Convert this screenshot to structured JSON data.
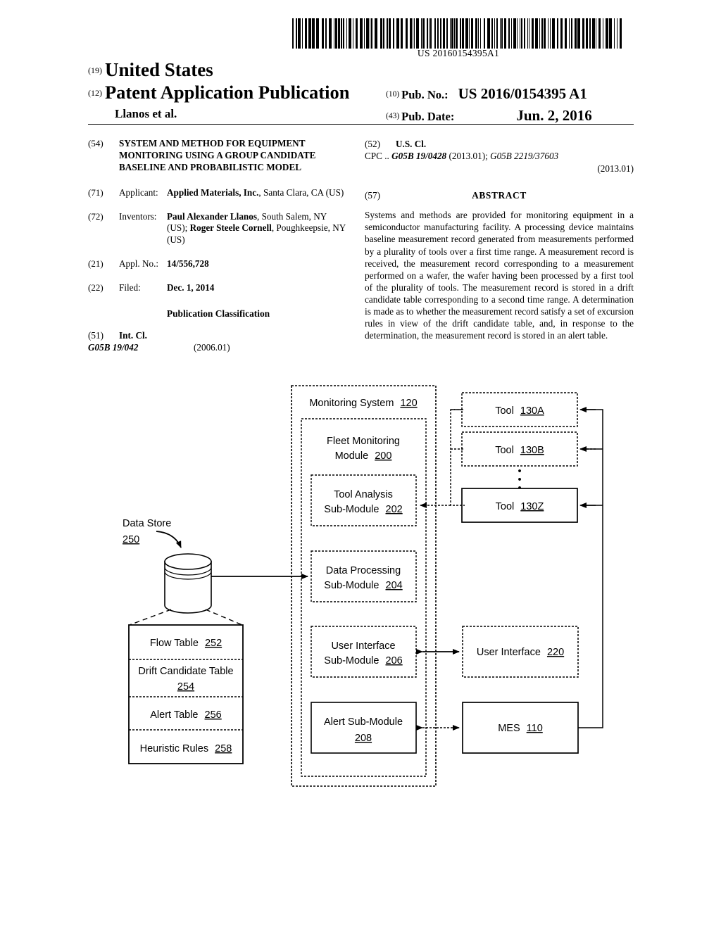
{
  "header": {
    "barcode_text": "US 20160154395A1",
    "country_num": "(19)",
    "country": "United States",
    "doc_type_num": "(12)",
    "doc_type": "Patent Application Publication",
    "author_line": "Llanos et al.",
    "pub_no_num": "(10)",
    "pub_no_label": "Pub. No.:",
    "pub_no_value": "US 2016/0154395 A1",
    "pub_date_num": "(43)",
    "pub_date_label": "Pub. Date:",
    "pub_date_value": "Jun. 2, 2016"
  },
  "left_column": {
    "title_num": "(54)",
    "title": "SYSTEM AND METHOD FOR EQUIPMENT MONITORING USING A GROUP CANDIDATE BASELINE AND PROBABILISTIC MODEL",
    "applicant_num": "(71)",
    "applicant_label": "Applicant:",
    "applicant_name": "Applied Materials, Inc.",
    "applicant_rest": ", Santa Clara, CA (US)",
    "inventors_num": "(72)",
    "inventors_label": "Inventors:",
    "inventor1_name": "Paul Alexander Llanos",
    "inventor1_rest": ", South Salem, NY (US); ",
    "inventor2_name": "Roger Steele Cornell",
    "inventor2_rest": ", Poughkeepsie, NY (US)",
    "appl_no_num": "(21)",
    "appl_no_label": "Appl. No.:",
    "appl_no_value": "14/556,728",
    "filed_num": "(22)",
    "filed_label": "Filed:",
    "filed_value": "Dec. 1, 2014",
    "publication_classification": "Publication Classification",
    "int_cl_num": "(51)",
    "int_cl_label": "Int. Cl.",
    "int_cl_code": "G05B 19/042",
    "int_cl_version": "(2006.01)"
  },
  "right_column": {
    "us_cl_num": "(52)",
    "us_cl_label": "U.S. Cl.",
    "cpc_prefix": "CPC ..",
    "cpc_code1": "G05B 19/0428",
    "cpc_ver1": "(2013.01); ",
    "cpc_code2": "G05B 2219/37603",
    "cpc_ver2": "(2013.01)",
    "abstract_num": "(57)",
    "abstract_title": "ABSTRACT",
    "abstract_text": "Systems and methods are provided for monitoring equipment in a semiconductor manufacturing facility. A processing device maintains baseline measurement record generated from measurements performed by a plurality of tools over a first time range. A measurement record is received, the measurement record corresponding to a measurement performed on a wafer, the wafer having been processed by a first tool of the plurality of tools. The measurement record is stored in a drift candidate table corresponding to a second time range. A determination is made as to whether the measurement record satisfy a set of excursion rules in view of the drift candidate table, and, in response to the determination, the measurement record is stored in an alert table."
  },
  "figure": {
    "monitoring_system": {
      "label": "Monitoring System",
      "ref": "120"
    },
    "fleet_module": {
      "label_line1": "Fleet Monitoring",
      "label_line2": "Module",
      "ref": "200"
    },
    "submodules": [
      {
        "line1": "Tool Analysis",
        "line2": "Sub-Module",
        "ref": "202"
      },
      {
        "line1": "Data Processing",
        "line2": "Sub-Module",
        "ref": "204"
      },
      {
        "line1": "User Interface",
        "line2": "Sub-Module",
        "ref": "206"
      },
      {
        "line1": "Alert Sub-Module",
        "line2": "",
        "ref": "208"
      }
    ],
    "tools": [
      {
        "label": "Tool",
        "ref": "130A"
      },
      {
        "label": "Tool",
        "ref": "130B"
      },
      {
        "label": "Tool",
        "ref": "130Z"
      }
    ],
    "tools_ellipsis": "•",
    "user_interface": {
      "label": "User Interface",
      "ref": "220"
    },
    "mes": {
      "label": "MES",
      "ref": "110"
    },
    "data_store": {
      "label": "Data Store",
      "ref": "250"
    },
    "tables": [
      {
        "line1": "Flow Table",
        "line2": "",
        "ref": "252"
      },
      {
        "line1": "Drift Candidate Table",
        "line2": "",
        "ref": "254"
      },
      {
        "line1": "Alert Table",
        "line2": "",
        "ref": "256"
      },
      {
        "line1": "Heuristic Rules",
        "line2": "",
        "ref": "258"
      }
    ]
  }
}
